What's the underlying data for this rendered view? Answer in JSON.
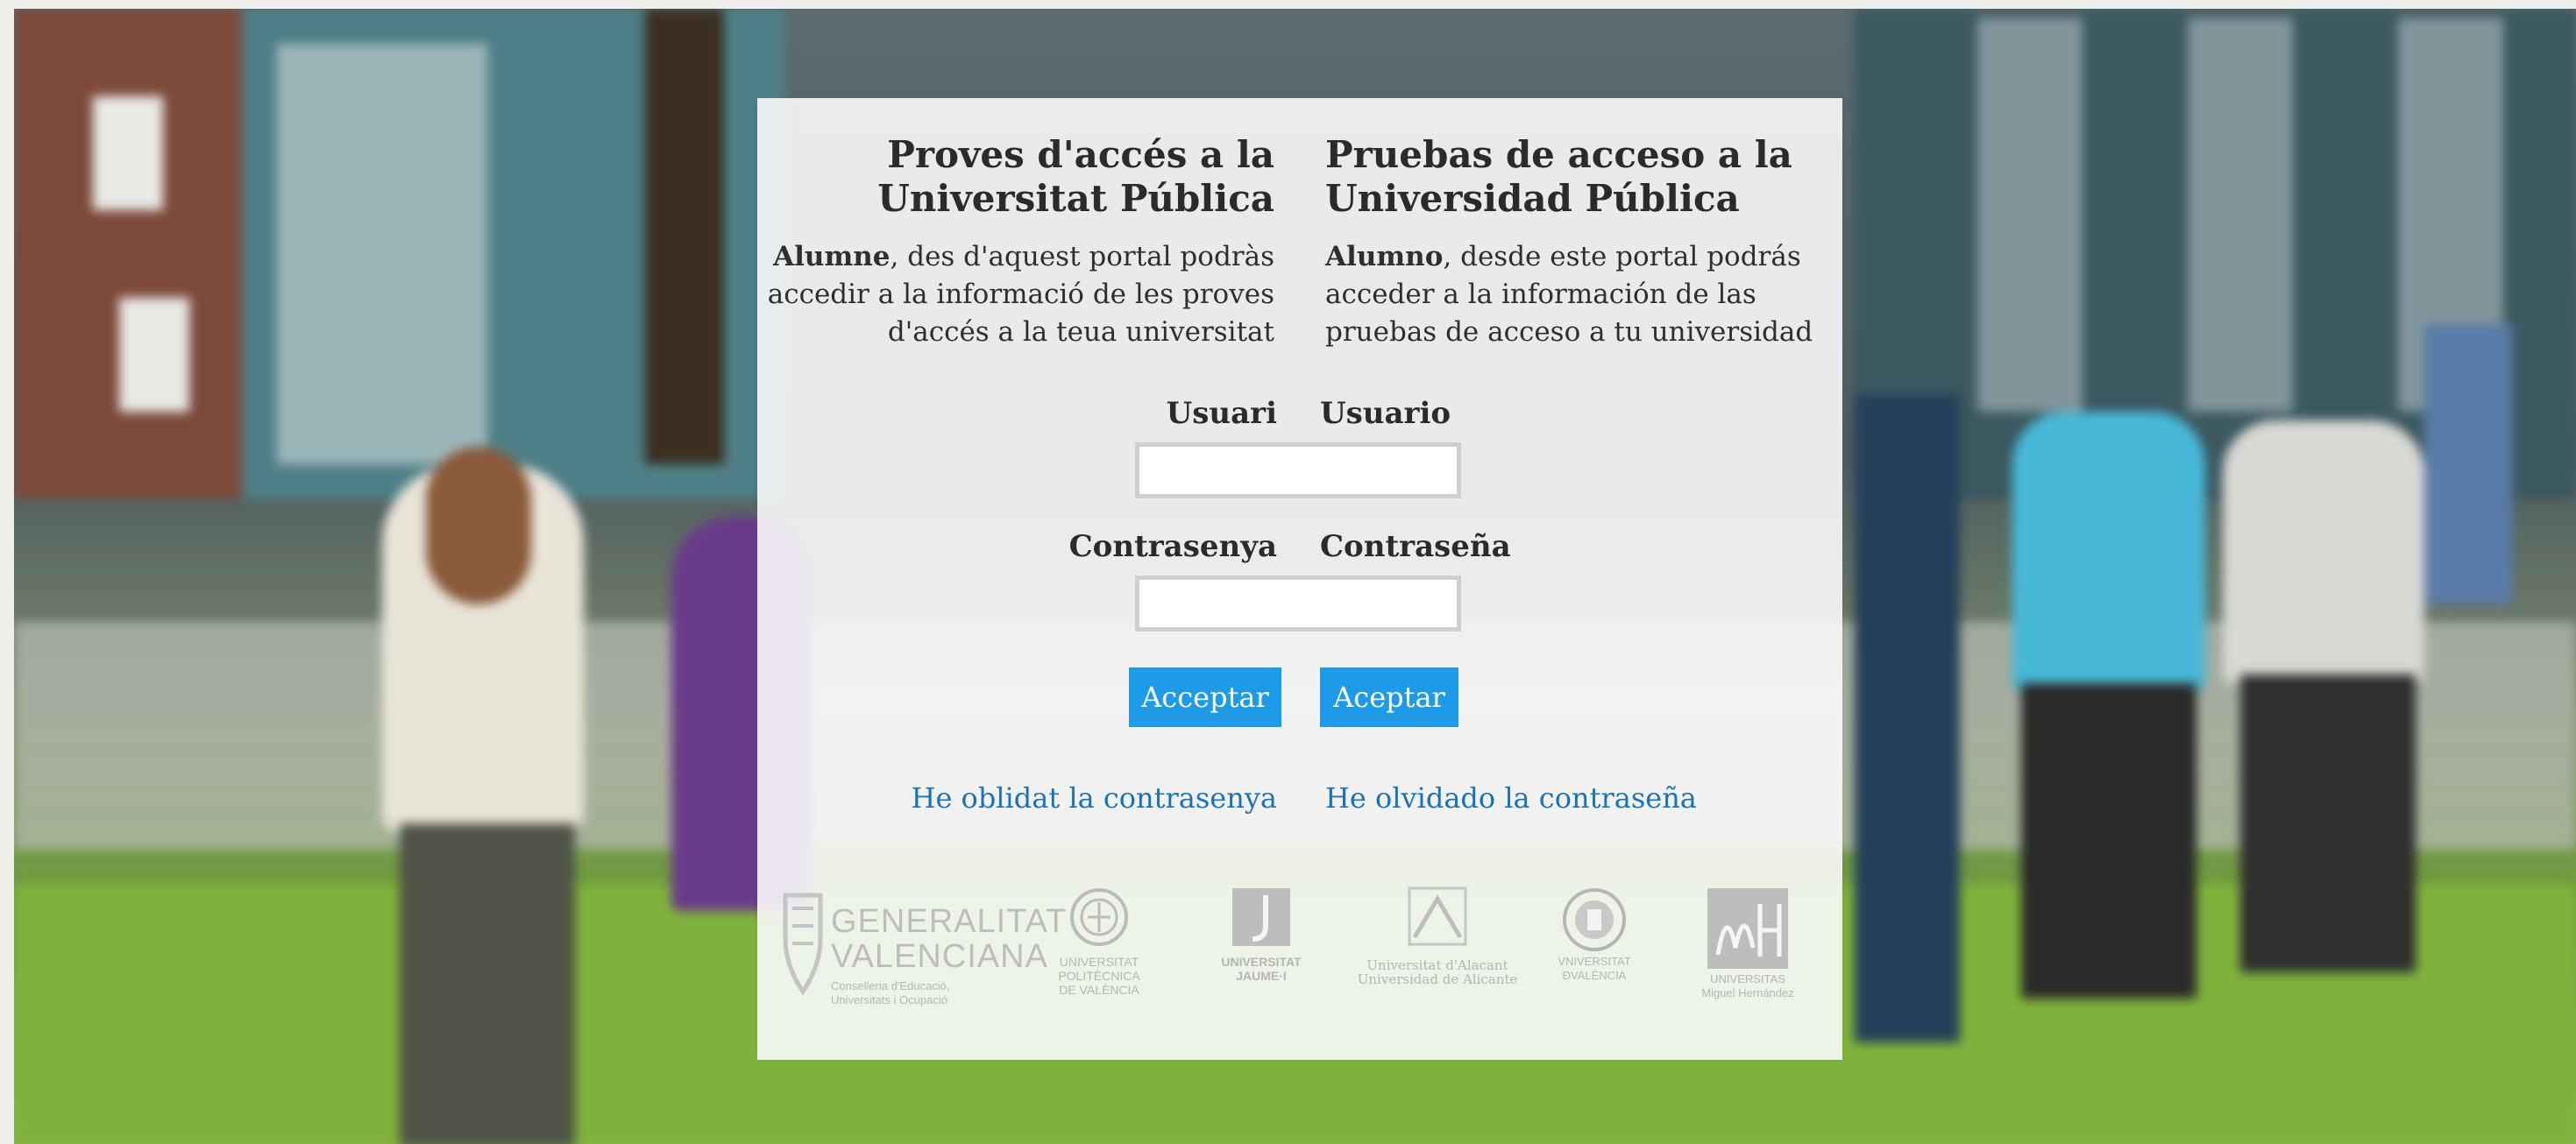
{
  "left_column": {
    "title_line1": "Proves d'accés a la",
    "title_line2": "Universitat Pública",
    "desc_bold": "Alumne",
    "desc_rest_1": ", des d'aquest portal podràs",
    "desc_rest_2": "accedir a la informació de les proves",
    "desc_rest_3": "d'accés a la teua universitat"
  },
  "right_column": {
    "title_line1": "Pruebas de acceso a la",
    "title_line2": "Universidad Pública",
    "desc_bold": "Alumno",
    "desc_rest_1": ", desde este portal podrás",
    "desc_rest_2": "acceder a la información de las",
    "desc_rest_3": "pruebas de acceso a tu universidad"
  },
  "form": {
    "user_label_va": "Usuari",
    "user_label_es": "Usuario",
    "user_value": "",
    "password_label_va": "Contrasenya",
    "password_label_es": "Contraseña",
    "password_value": "",
    "accept_va": "Acceptar",
    "accept_es": "Aceptar"
  },
  "links": {
    "forgot_va": "He oblidat la contrasenya",
    "forgot_es": "He olvidado la contraseña"
  },
  "logos": {
    "gva_line1": "GENERALITAT",
    "gva_line2": "VALENCIANA",
    "gva_sub1": "Conselleria d'Educació,",
    "gva_sub2": "Universitats i Ocupació",
    "upv_1": "UNIVERSITAT",
    "upv_2": "POLITÈCNICA",
    "upv_3": "DE VALÈNCIA",
    "uji_1": "UNIVERSITAT",
    "uji_2": "JAUME·I",
    "ua_1": "Universitat d'Alacant",
    "ua_2": "Universidad de Alicante",
    "uv_1": "VNIVERSITAT",
    "uv_2": "ÐVALÈNCIA",
    "umh_1": "UNIVERSITAS",
    "umh_2": "Miguel Hernández"
  },
  "colors": {
    "accent_button": "#1e9be8",
    "link": "#1a72b8"
  }
}
